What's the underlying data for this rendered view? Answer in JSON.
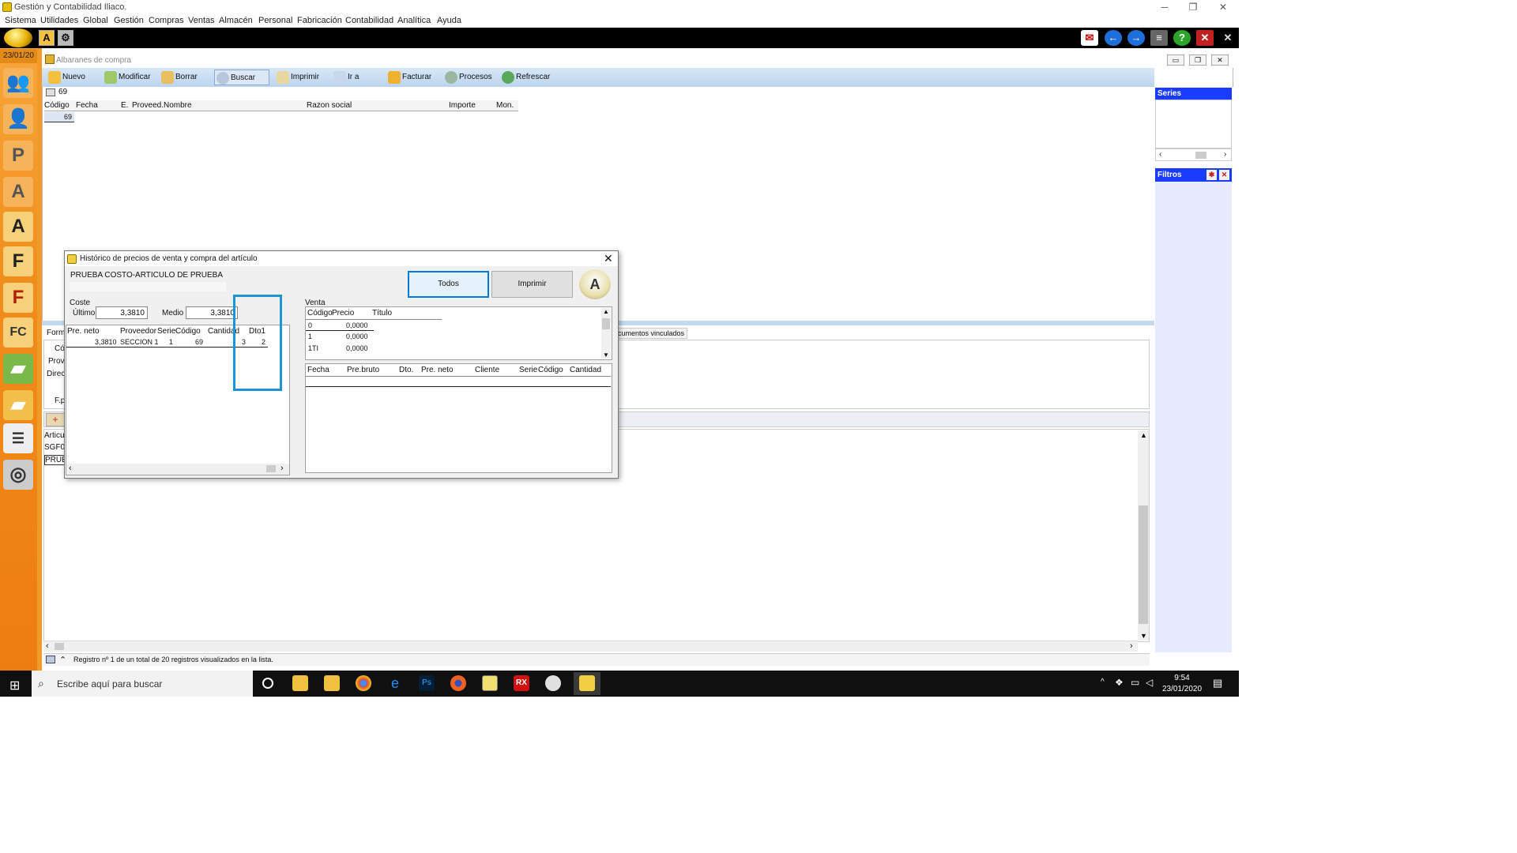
{
  "app": {
    "title": "Gestión y Contabilidad Iliaco.",
    "menu": [
      "Sistema",
      "Utilidades",
      "Global",
      "Gestión",
      "Compras",
      "Ventas",
      "Almacén",
      "Personal",
      "Fabricación",
      "Contabilidad",
      "Analítica",
      "Ayuda"
    ],
    "date_label": "23/01/20"
  },
  "child_window": {
    "title": "Albaranes de compra",
    "toolbar": [
      "Nuevo",
      "Modificar",
      "Borrar",
      "Buscar",
      "Imprimir",
      "Ir a",
      "Facturar",
      "Procesos",
      "Refrescar"
    ],
    "active_tool": "Buscar",
    "filter_value": "69",
    "grid": {
      "columns": [
        "Código",
        "Fecha",
        "E.",
        "Proveed.",
        "Nombre",
        "Razon social",
        "Importe",
        "Mon."
      ],
      "rows": [
        [
          "69",
          "",
          "",
          "",
          "",
          "",
          "",
          ""
        ]
      ]
    },
    "lower": {
      "tab_label": "cumentos vinculados",
      "left_labels": [
        "Formu",
        "Có",
        "Prove",
        "Direc",
        "F.p"
      ],
      "grid_rows": [
        "Articu",
        "SGF00",
        "PRUE"
      ]
    },
    "status": "Registro nº 1 de un total de 20 registros visualizados en la lista."
  },
  "right_panel": {
    "series_label": "Series",
    "filtros_label": "Filtros"
  },
  "dialog": {
    "title": "Histórico de precios de venta y compra del artículo",
    "article": "PRUEBA COSTO-ARTICULO DE PRUEBA",
    "buttons": {
      "todos": "Todos",
      "imprimir": "Imprimir"
    },
    "coste": {
      "label": "Coste",
      "ultimo_label": "Último",
      "ultimo_value": "3,3810",
      "medio_label": "Medio",
      "medio_value": "3,3810"
    },
    "compras_grid": {
      "columns": [
        "Pre. neto",
        "Proveedor",
        "Serie",
        "Código",
        "Cantidad",
        "Dto1"
      ],
      "rows": [
        [
          "3,3810",
          "SECCION 1",
          "1",
          "69",
          "3",
          "2"
        ]
      ]
    },
    "venta": {
      "label": "Venta",
      "tarifas_columns": [
        "Código",
        "Precio",
        "Título"
      ],
      "tarifas_rows": [
        [
          "0",
          "0,0000",
          ""
        ],
        [
          "1",
          "0,0000",
          ""
        ],
        [
          "1TI",
          "0,0000",
          ""
        ]
      ],
      "historial_columns": [
        "Fecha",
        "Pre.bruto",
        "Dto.",
        "Pre. neto",
        "Cliente",
        "Serie",
        "Código",
        "Cantidad"
      ]
    }
  },
  "taskbar": {
    "search_placeholder": "Escribe aquí para buscar",
    "time": "9:54",
    "date": "23/01/2020"
  },
  "colors": {
    "accent_blue": "#1a3cff",
    "sidebar_orange": "#f08c1a",
    "highlight_box": "#1c94d8"
  }
}
